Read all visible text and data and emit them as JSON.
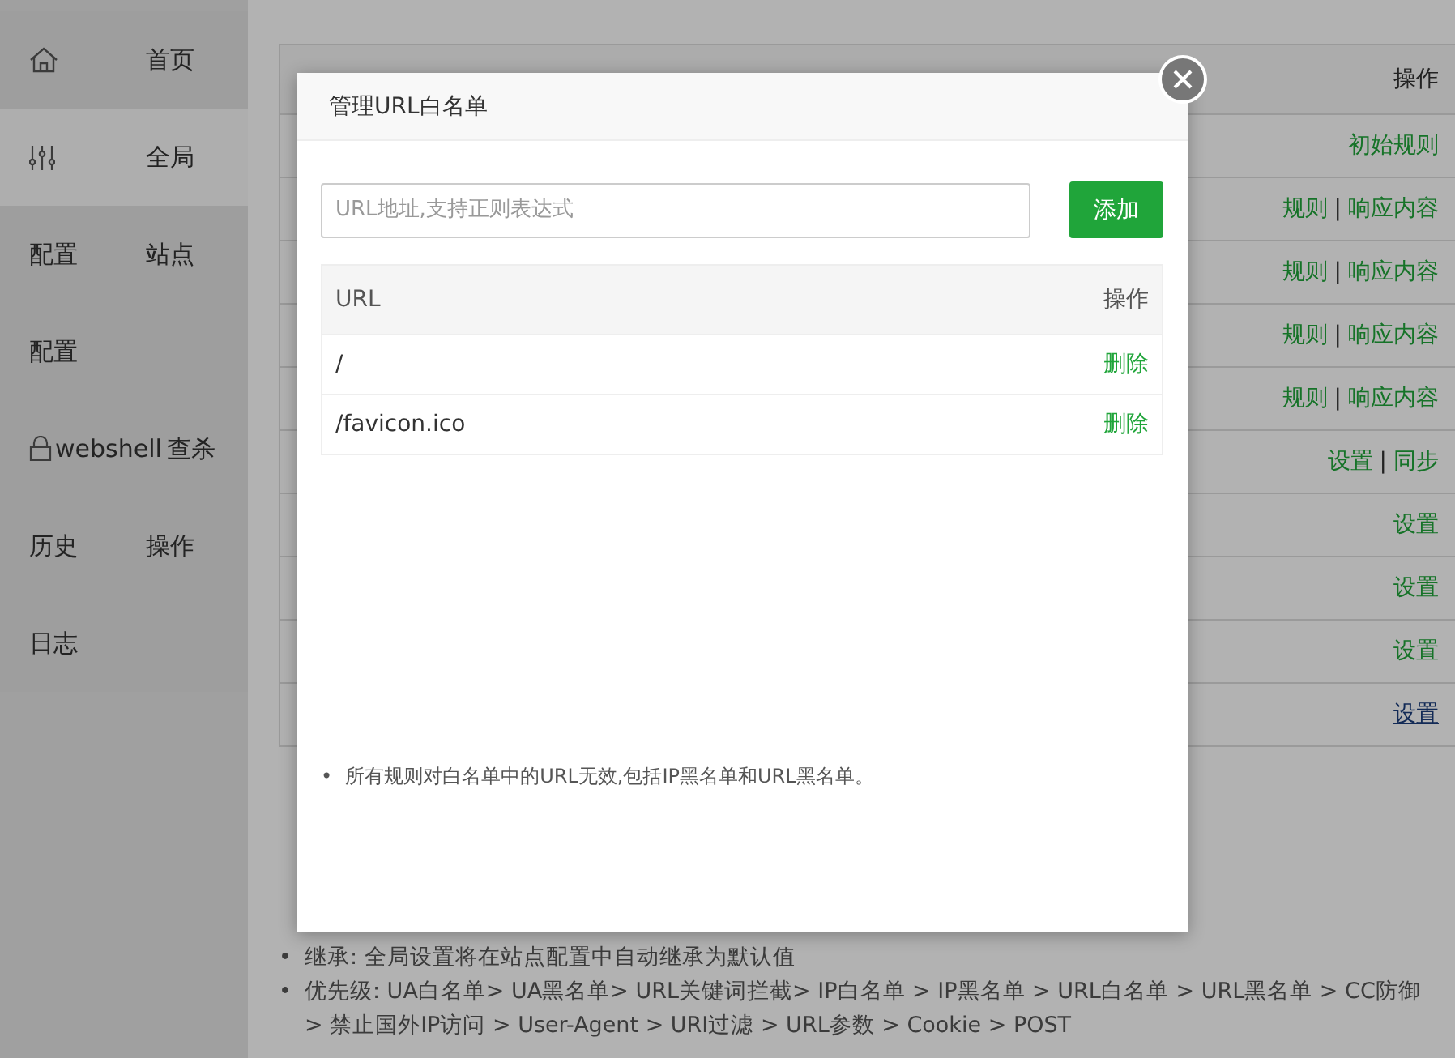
{
  "sidebar": {
    "items": [
      {
        "label": "首页",
        "selected": false
      },
      {
        "label": "全局",
        "selected": true
      },
      {
        "prefix": "配置",
        "label": "站点",
        "selected": false
      },
      {
        "prefix": "配置",
        "selected": false
      },
      {
        "prefix": "webshell",
        "label": "查杀",
        "selected": false
      },
      {
        "prefix": "历史",
        "label": "操作",
        "selected": false
      },
      {
        "prefix": "日志",
        "selected": false
      }
    ]
  },
  "table": {
    "columns": [
      {
        "label": "操作"
      }
    ],
    "rows": [
      {
        "actions": [
          {
            "label": "初始规则",
            "hovered": false
          }
        ]
      },
      {
        "actions": [
          {
            "label": "规则",
            "hovered": false
          },
          {
            "kind": "separator",
            "label": "|"
          },
          {
            "label": "响应内容",
            "hovered": false
          }
        ]
      },
      {
        "actions": [
          {
            "label": "规则",
            "hovered": false
          },
          {
            "kind": "separator",
            "label": "|"
          },
          {
            "label": "响应内容",
            "hovered": false
          }
        ]
      },
      {
        "actions": [
          {
            "label": "规则",
            "hovered": false
          },
          {
            "kind": "separator",
            "label": "|"
          },
          {
            "label": "响应内容",
            "hovered": false
          }
        ]
      },
      {
        "actions": [
          {
            "label": "规则",
            "hovered": false
          },
          {
            "kind": "separator",
            "label": "|"
          },
          {
            "label": "响应内容",
            "hovered": false
          }
        ]
      },
      {
        "actions": [
          {
            "label": "设置",
            "hovered": false
          },
          {
            "kind": "separator",
            "label": "|"
          },
          {
            "label": "同步",
            "hovered": false
          }
        ]
      },
      {
        "actions": [
          {
            "label": "设置",
            "hovered": false
          }
        ]
      },
      {
        "actions": [
          {
            "label": "设置",
            "hovered": false
          }
        ]
      },
      {
        "actions": [
          {
            "label": "设置",
            "hovered": false
          }
        ]
      },
      {
        "actions": [
          {
            "label": "设置",
            "hovered": true
          }
        ]
      }
    ]
  },
  "notes": [
    {
      "bullet": "•",
      "text": "继承: 全局设置将在站点配置中自动继承为默认值"
    },
    {
      "bullet": "•",
      "text": "优先级: UA白名单> UA黑名单> URL关键词拦截> IP白名单 > IP黑名单 > URL白名单 > URL黑名单 > CC防御 > 禁止国外IP访问 > User-Agent > URI过滤 > URL参数 > Cookie > POST"
    }
  ],
  "dialog": {
    "title": "管理URL白名单",
    "input": {
      "placeholder": "URL地址,支持正则表达式"
    },
    "add_button": "添加",
    "table": {
      "columns": [
        "URL",
        "操作"
      ],
      "rows": [
        {
          "url": "/",
          "action": "删除"
        },
        {
          "url": "/favicon.ico",
          "action": "删除"
        }
      ]
    },
    "notes": [
      {
        "bullet": "•",
        "text": "所有规则对白名单中的URL无效,包括IP黑名单和URL黑名单。"
      }
    ]
  }
}
